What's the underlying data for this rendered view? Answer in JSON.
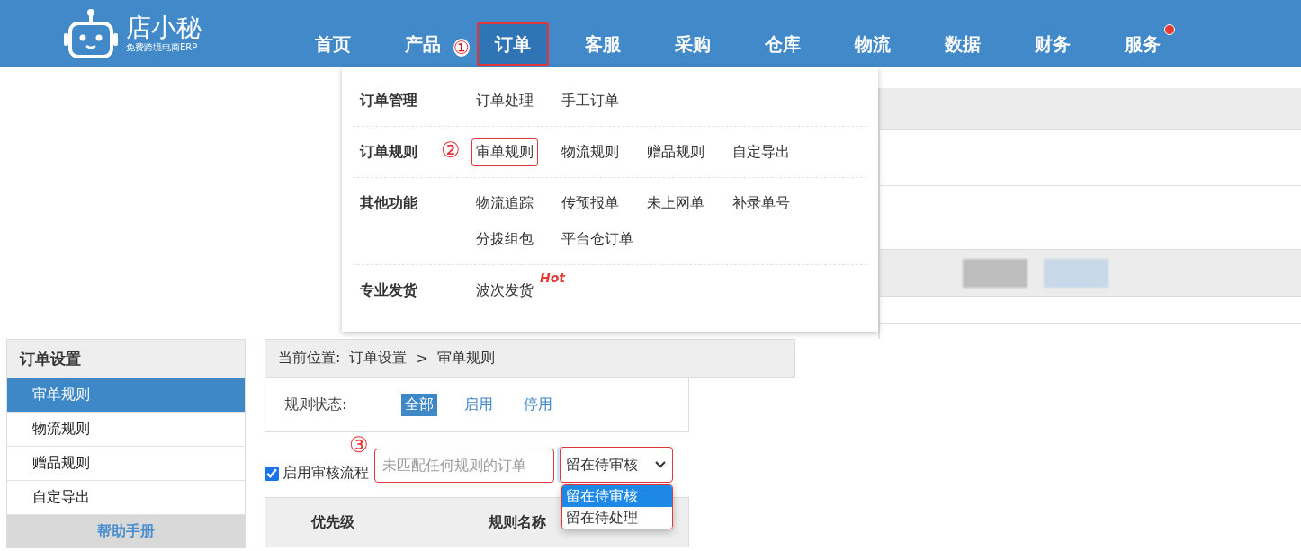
{
  "header": {
    "logo": {
      "name": "店小秘",
      "tagline": "免费跨境电商ERP"
    },
    "nav": [
      {
        "label": "首页",
        "selected": false,
        "highlighted": false,
        "notification": false
      },
      {
        "label": "产品",
        "selected": false,
        "highlighted": false,
        "notification": false
      },
      {
        "label": "订单",
        "selected": true,
        "highlighted": true,
        "notification": false,
        "annotation": "①"
      },
      {
        "label": "客服",
        "selected": false,
        "highlighted": false,
        "notification": false
      },
      {
        "label": "采购",
        "selected": false,
        "highlighted": false,
        "notification": false
      },
      {
        "label": "仓库",
        "selected": false,
        "highlighted": false,
        "notification": false
      },
      {
        "label": "物流",
        "selected": false,
        "highlighted": false,
        "notification": false
      },
      {
        "label": "数据",
        "selected": false,
        "highlighted": false,
        "notification": false
      },
      {
        "label": "财务",
        "selected": false,
        "highlighted": false,
        "notification": false
      },
      {
        "label": "服务",
        "selected": false,
        "highlighted": false,
        "notification": true
      }
    ]
  },
  "menu": {
    "groups": [
      {
        "title": "订单管理",
        "items": [
          {
            "label": "订单处理",
            "highlighted": false
          },
          {
            "label": "手工订单",
            "highlighted": false
          }
        ]
      },
      {
        "title": "订单规则",
        "items": [
          {
            "label": "审单规则",
            "highlighted": true,
            "annotation": "②"
          },
          {
            "label": "物流规则",
            "highlighted": false
          },
          {
            "label": "赠品规则",
            "highlighted": false
          },
          {
            "label": "自定导出",
            "highlighted": false
          }
        ]
      },
      {
        "title": "其他功能",
        "items": [
          {
            "label": "物流追踪",
            "highlighted": false
          },
          {
            "label": "传预报单",
            "highlighted": false
          },
          {
            "label": "未上网单",
            "highlighted": false
          },
          {
            "label": "补录单号",
            "highlighted": false
          },
          {
            "label": "分拨组包",
            "highlighted": false
          },
          {
            "label": "平台仓订单",
            "highlighted": false
          }
        ]
      },
      {
        "title": "专业发货",
        "items": [
          {
            "label": "波次发货",
            "highlighted": false,
            "tag": "Hot"
          }
        ]
      }
    ]
  },
  "sidebar": {
    "title": "订单设置",
    "items": [
      {
        "label": "审单规则",
        "selected": true
      },
      {
        "label": "物流规则",
        "selected": false
      },
      {
        "label": "赠品规则",
        "selected": false
      },
      {
        "label": "自定导出",
        "selected": false
      }
    ],
    "help": "帮助手册"
  },
  "main": {
    "breadcrumb": {
      "label": "当前位置:",
      "path": [
        "订单设置",
        "审单规则"
      ],
      "separator": ">"
    },
    "filter": {
      "label": "规则状态:",
      "options": [
        {
          "label": "全部",
          "selected": true
        },
        {
          "label": "启用",
          "selected": false
        },
        {
          "label": "停用",
          "selected": false
        }
      ]
    },
    "review": {
      "annotation": "③",
      "checkbox": {
        "label": "启用审核流程",
        "checked": true
      },
      "field": {
        "placeholder": "未匹配任何规则的订单",
        "highlighted": true
      },
      "select": {
        "value": "留在待审核",
        "highlighted": true,
        "expanded": true,
        "options": [
          {
            "label": "留在待审核",
            "selected": true
          },
          {
            "label": "留在待处理",
            "selected": false
          }
        ]
      }
    },
    "table": {
      "columns": [
        "优先级",
        "规则名称"
      ]
    }
  }
}
